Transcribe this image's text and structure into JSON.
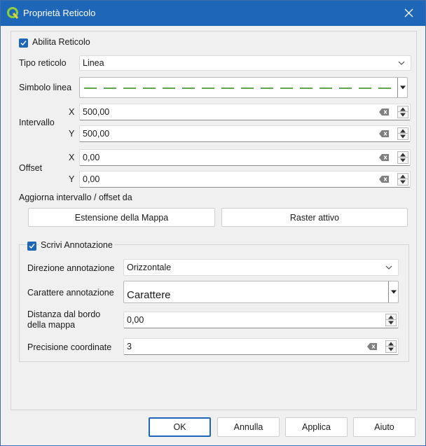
{
  "window": {
    "title": "Proprietà Reticolo"
  },
  "enable_grid": {
    "label": "Abilita Reticolo",
    "checked": true
  },
  "grid_type": {
    "label": "Tipo reticolo",
    "value": "Linea"
  },
  "line_symbol": {
    "label": "Simbolo linea",
    "color": "#5fa64a"
  },
  "interval": {
    "label": "Intervallo",
    "x_label": "X",
    "x_value": "500,00",
    "y_label": "Y",
    "y_value": "500,00"
  },
  "offset": {
    "label": "Offset",
    "x_label": "X",
    "x_value": "0,00",
    "y_label": "Y",
    "y_value": "0,00"
  },
  "update_from": {
    "label": "Aggiorna intervallo / offset da",
    "map_extent_button": "Estensione della Mappa",
    "active_raster_button": "Raster attivo"
  },
  "annotation": {
    "label": "Scrivi Annotazione",
    "checked": true,
    "direction_label": "Direzione annotazione",
    "direction_value": "Orizzontale",
    "font_label": "Carattere annotazione",
    "font_value": "Carattere",
    "distance_label": "Distanza dal bordo della mappa",
    "distance_value": "0,00",
    "precision_label": "Precisione coordinate",
    "precision_value": "3"
  },
  "footer": {
    "ok": "OK",
    "cancel": "Annulla",
    "apply": "Applica",
    "help": "Aiuto"
  },
  "colors": {
    "accent": "#1e66b7",
    "line_symbol": "#5fa64a"
  }
}
